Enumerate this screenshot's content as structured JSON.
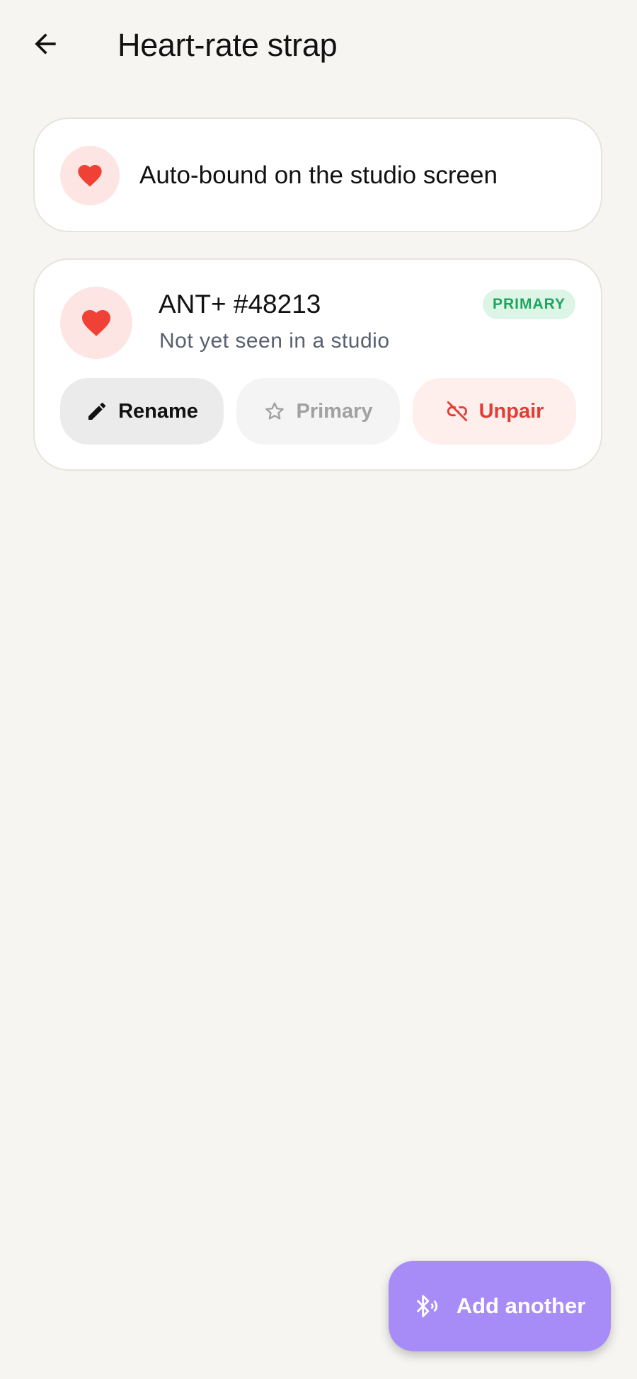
{
  "header": {
    "back_icon": "arrow-left-icon",
    "title": "Heart-rate strap"
  },
  "info_card": {
    "icon": "heart-icon",
    "text": "Auto-bound on the studio screen"
  },
  "device": {
    "icon": "heart-icon",
    "name": "ANT+ #48213",
    "status": "Not yet seen in a studio",
    "badge": "PRIMARY",
    "actions": [
      {
        "label": "Rename",
        "icon": "pencil-icon",
        "enabled": true
      },
      {
        "label": "Primary",
        "icon": "star-icon",
        "enabled": false
      },
      {
        "label": "Unpair",
        "icon": "link-off-icon",
        "enabled": true
      }
    ]
  },
  "fab": {
    "icon": "bluetooth-searching-icon",
    "label": "Add another"
  },
  "colors": {
    "background": "#F6F5F1",
    "heart": "#EF4136",
    "heart_bg": "#FDE5E3",
    "badge_text": "#1FA45E",
    "badge_bg": "#DCF5E6",
    "danger": "#E23D33",
    "accent": "#A78BF7"
  }
}
